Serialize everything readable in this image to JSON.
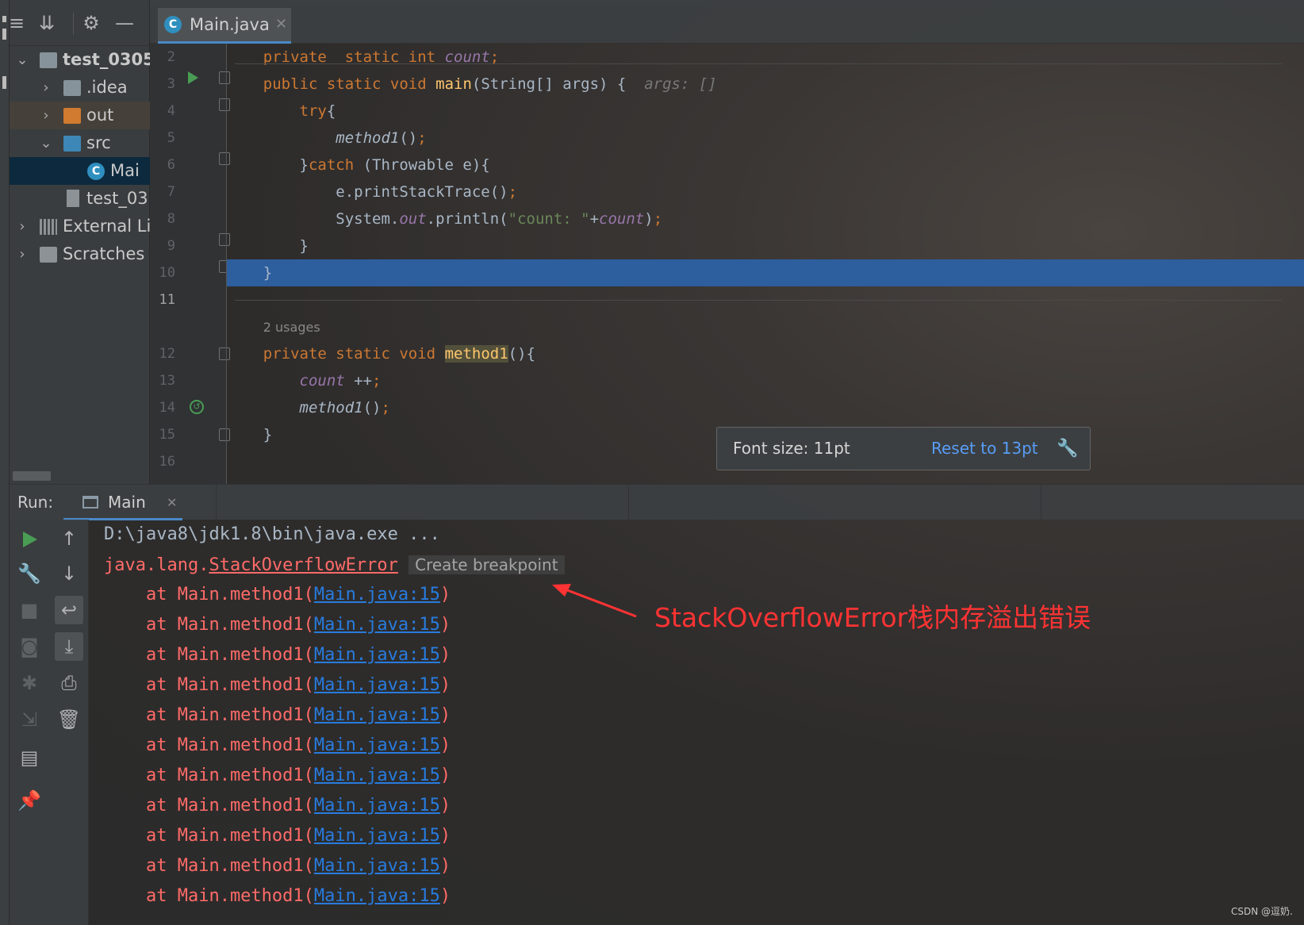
{
  "project_panel": {
    "tree": [
      {
        "label": "test_0305",
        "expanded": true
      },
      {
        "label": ".idea"
      },
      {
        "label": "out"
      },
      {
        "label": "src",
        "expanded": true
      },
      {
        "label": "Mai"
      },
      {
        "label": "test_03"
      },
      {
        "label": "External Li"
      },
      {
        "label": "Scratches"
      }
    ]
  },
  "editor": {
    "tab_label": "Main.java",
    "tab_close": "✕",
    "line_numbers": [
      "2",
      "3",
      "4",
      "5",
      "6",
      "7",
      "8",
      "9",
      "10",
      "11",
      "12",
      "13",
      "14",
      "15",
      "16"
    ],
    "usages_hint": "2 usages",
    "args_hint": "args: []"
  },
  "font_popup": {
    "label": "Font size: 11pt",
    "reset_link": "Reset to 13pt"
  },
  "run_panel": {
    "run_label": "Run:",
    "tab_label": "Main",
    "tab_close": "✕",
    "console": {
      "command": "D:\\java8\\jdk1.8\\bin\\java.exe ...",
      "error_prefix": "java.lang.",
      "error_class": "StackOverflowError",
      "breakpoint_hint": "Create breakpoint",
      "trace_prefix": "    at Main.method1(",
      "trace_link": "Main.java:15",
      "trace_suffix": ")",
      "trace_count": 11
    }
  },
  "annotation": "StackOverflowError栈内存溢出错误",
  "watermark": "CSDN @逗奶.",
  "colors": {
    "keyword": "#cc7832",
    "function": "#ffc66d",
    "field": "#9876aa",
    "error_text": "#ff6b68",
    "link": "#287bde",
    "selection": "#2d5e9e",
    "annotation": "#ff3333"
  }
}
